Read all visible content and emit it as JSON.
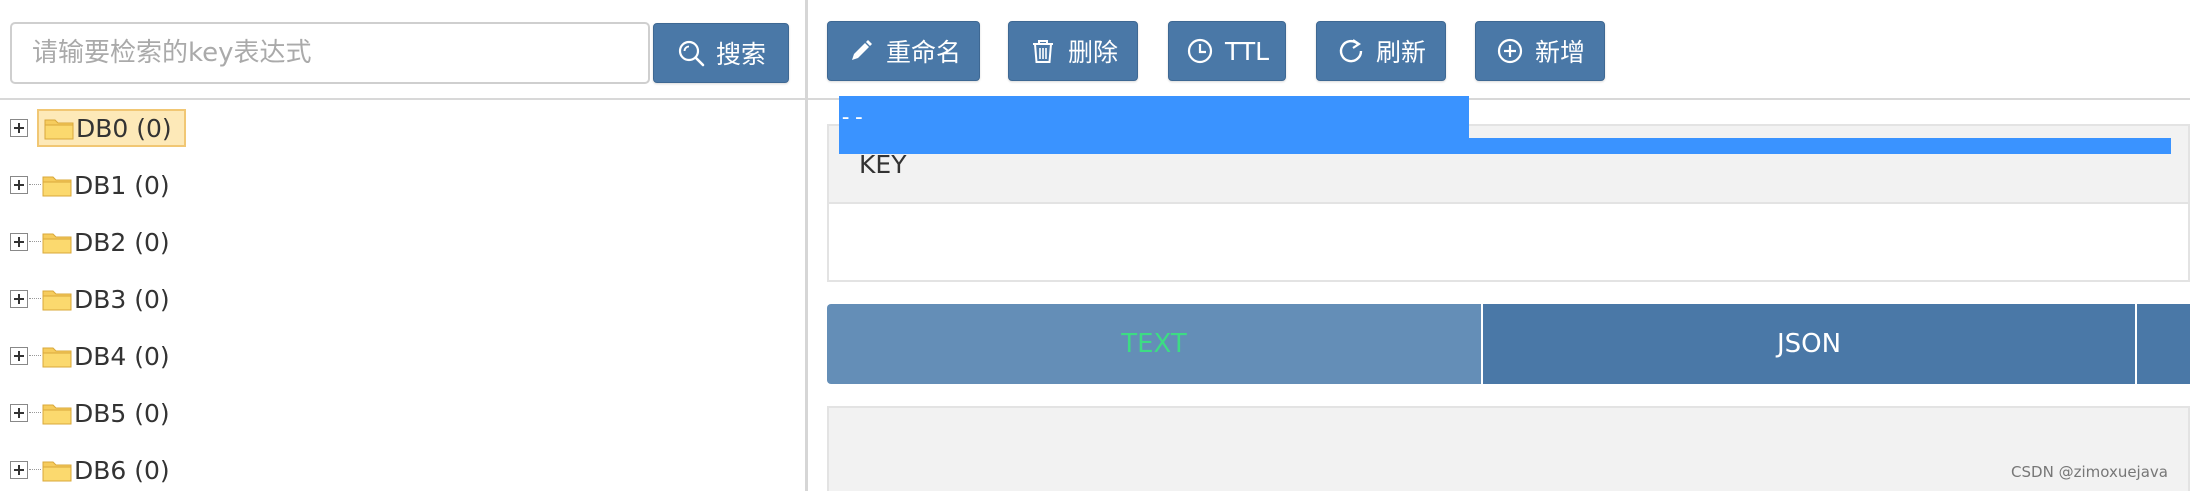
{
  "search": {
    "placeholder": "请输要检索的key表达式",
    "button_label": "搜索"
  },
  "tree": {
    "items": [
      {
        "label": "DB0 (0)",
        "selected": true
      },
      {
        "label": "DB1 (0)",
        "selected": false
      },
      {
        "label": "DB2 (0)",
        "selected": false
      },
      {
        "label": "DB3 (0)",
        "selected": false
      },
      {
        "label": "DB4 (0)",
        "selected": false
      },
      {
        "label": "DB5 (0)",
        "selected": false
      },
      {
        "label": "DB6 (0)",
        "selected": false
      }
    ]
  },
  "toolbar": {
    "rename_label": "重命名",
    "delete_label": "删除",
    "ttl_label": "TTL",
    "refresh_label": "刷新",
    "add_label": "新增"
  },
  "key_panel": {
    "header": "KEY",
    "value": "--"
  },
  "tabs": [
    {
      "label": "TEXT",
      "active": true
    },
    {
      "label": "JSON",
      "active": false
    }
  ],
  "colors": {
    "button_bg": "#4a78a7",
    "active_tab_bg": "#648eb7",
    "active_tab_text": "#3ddc84",
    "selection": "#3a93ff",
    "selected_node_bg": "#fde9b8"
  },
  "watermark": "CSDN @zimoxuejava"
}
